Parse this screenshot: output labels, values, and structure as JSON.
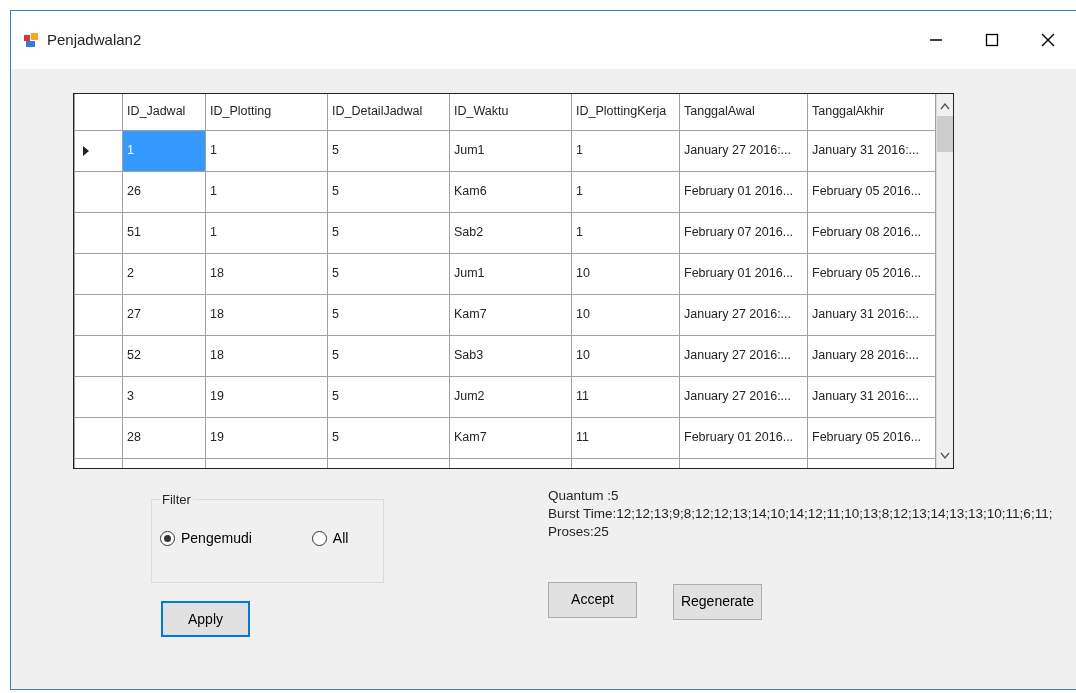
{
  "window": {
    "title": "Penjadwalan2"
  },
  "table": {
    "columns": [
      "ID_Jadwal",
      "ID_Plotting",
      "ID_DetailJadwal",
      "ID_Waktu",
      "ID_PlottingKerja",
      "TanggalAwal",
      "TanggalAkhir"
    ],
    "rows": [
      {
        "selected": true,
        "cells": [
          "1",
          "1",
          "5",
          "Jum1",
          "1",
          "January 27 2016:...",
          "January 31 2016:..."
        ]
      },
      {
        "selected": false,
        "cells": [
          "26",
          "1",
          "5",
          "Kam6",
          "1",
          "February 01 2016...",
          "February 05 2016..."
        ]
      },
      {
        "selected": false,
        "cells": [
          "51",
          "1",
          "5",
          "Sab2",
          "1",
          "February 07 2016...",
          "February 08 2016..."
        ]
      },
      {
        "selected": false,
        "cells": [
          "2",
          "18",
          "5",
          "Jum1",
          "10",
          "February 01 2016...",
          "February 05 2016..."
        ]
      },
      {
        "selected": false,
        "cells": [
          "27",
          "18",
          "5",
          "Kam7",
          "10",
          "January 27 2016:...",
          "January 31 2016:..."
        ]
      },
      {
        "selected": false,
        "cells": [
          "52",
          "18",
          "5",
          "Sab3",
          "10",
          "January 27 2016:...",
          "January 28 2016:..."
        ]
      },
      {
        "selected": false,
        "cells": [
          "3",
          "19",
          "5",
          "Jum2",
          "11",
          "January 27 2016:...",
          "January 31 2016:..."
        ]
      },
      {
        "selected": false,
        "cells": [
          "28",
          "19",
          "5",
          "Kam7",
          "11",
          "February 01 2016...",
          "February 05 2016..."
        ]
      }
    ]
  },
  "filter": {
    "title": "Filter",
    "options": [
      {
        "label": "Pengemudi",
        "selected": true
      },
      {
        "label": "All",
        "selected": false
      }
    ]
  },
  "info": [
    "Quantum :5",
    "Burst Time:12;12;13;9;8;12;12;13;14;10;14;12;11;10;13;8;12;13;14;13;13;10;11;6;11;",
    "Proses:25"
  ],
  "buttons": [
    {
      "label": "Apply",
      "focused": true
    },
    {
      "label": "Accept",
      "focused": false
    },
    {
      "label": "Regenerate",
      "focused": false
    }
  ]
}
